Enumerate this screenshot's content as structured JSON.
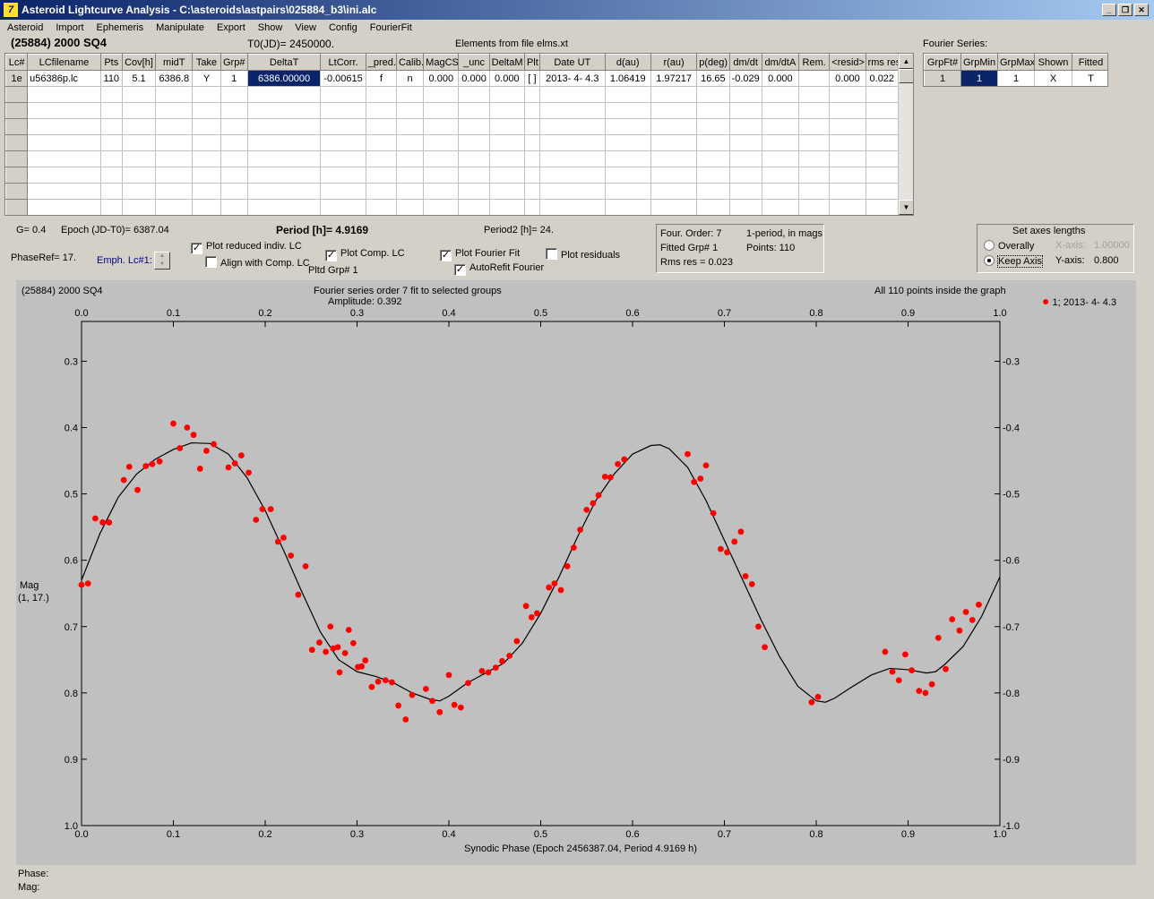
{
  "window": {
    "title": "Asteroid Lightcurve Analysis - C:\\asteroids\\astpairs\\025884_b3\\ini.alc",
    "icon": "app-icon"
  },
  "menu": [
    "Asteroid",
    "Import",
    "Ephemeris",
    "Manipulate",
    "Export",
    "Show",
    "View",
    "Config",
    "FourierFit"
  ],
  "header": {
    "asteroid": "(25884) 2000 SQ4",
    "t0": "T0(JD)= 2450000.",
    "elements": "Elements from file elms.xt",
    "fourier_series_label": "Fourier Series:"
  },
  "lc_table": {
    "columns": [
      "Lc#",
      "LCfilename",
      "Pts",
      "Cov[h]",
      "midT",
      "Take",
      "Grp#",
      "DeltaT",
      "LtCorr.",
      "_pred.",
      "Calib.",
      "MagCS",
      "_unc",
      "DeltaM",
      "Plt",
      "Date UT",
      "d(au)",
      "r(au)",
      "p(deg)",
      "dm/dt",
      "dm/dtA",
      "Rem.",
      "<resid>",
      "rms res"
    ],
    "rows": [
      [
        "1e",
        "u56386p.lc",
        "110",
        "5.1",
        "6386.8",
        "Y",
        "1",
        "6386.00000",
        "-0.00615",
        "f",
        "n",
        "0.000",
        "0.000",
        "0.000",
        "[ ]",
        "2013- 4- 4.3",
        "1.06419",
        "1.97217",
        "16.65",
        "-0.029",
        "0.000",
        "",
        "0.000",
        "0.022"
      ]
    ]
  },
  "fourier_table": {
    "columns": [
      "GrpFt#",
      "GrpMin",
      "GrpMax",
      "Shown",
      "Fitted"
    ],
    "rows": [
      [
        "1",
        "1",
        "1",
        "X",
        "T"
      ]
    ]
  },
  "controls": {
    "g": "G= 0.4",
    "epoch": "Epoch (JD-T0)= 6387.04",
    "period": "Period [h]= 4.9169",
    "period2": "Period2 [h]= 24.",
    "phase_ref": "PhaseRef= 17.",
    "emph": "Emph. Lc#1:",
    "plot_reduced": "Plot reduced indiv. LC",
    "align": "Align with Comp. LC",
    "plot_comp": "Plot Comp. LC",
    "pltd_grp": "Pltd Grp#  1",
    "plot_fourier": "Plot Fourier Fit",
    "autorefit": "AutoRefit Fourier",
    "plot_residuals": "Plot residuals"
  },
  "fit_info": {
    "order": "Four. Order:  7",
    "mode": "1-period, in mags",
    "fitted": "Fitted Grp# 1",
    "points": "Points: 110",
    "rms": "Rms res     = 0.023"
  },
  "axes_box": {
    "title": "Set axes lengths",
    "overally": "Overally",
    "keep_axis": "Keep Axis",
    "x_axis_label": "X-axis:",
    "x_axis_value": "1.00000",
    "y_axis_label": "Y-axis:",
    "y_axis_value": "0.800"
  },
  "plot": {
    "object": "(25884) 2000 SQ4",
    "title": "Fourier series order 7 fit to selected groups",
    "amplitude": "Amplitude: 0.392",
    "note": "All 110 points inside the graph",
    "legend": "1; 2013- 4- 4.3",
    "ylabel": "Mag",
    "ylabel2": "(1, 17.)",
    "xlabel": "Synodic Phase (Epoch 2456387.04, Period 4.9169 h)",
    "status_phase": "Phase:",
    "status_mag": "Mag:"
  },
  "colors": {
    "points": "#ff0000",
    "curve": "#000000",
    "plot_bg": "#c0c0c0",
    "titlebar": "#0a246a"
  },
  "chart_data": {
    "type": "scatter",
    "x_ticks": [
      "0.0",
      "0.1",
      "0.2",
      "0.3",
      "0.4",
      "0.5",
      "0.6",
      "0.7",
      "0.8",
      "0.9",
      "1.0"
    ],
    "y_ticks": [
      "0.3",
      "0.4",
      "0.5",
      "0.6",
      "0.7",
      "0.8",
      "0.9",
      "1.0"
    ],
    "xlim": [
      0,
      1
    ],
    "ylim": [
      0.24,
      1.0
    ],
    "y_inverted": true,
    "series": [
      {
        "name": "1; 2013- 4- 4.3",
        "color": "#ff0000",
        "points": [
          [
            0.0,
            0.637
          ],
          [
            0.007,
            0.635
          ],
          [
            0.015,
            0.537
          ],
          [
            0.023,
            0.543
          ],
          [
            0.03,
            0.543
          ],
          [
            0.046,
            0.479
          ],
          [
            0.052,
            0.459
          ],
          [
            0.061,
            0.494
          ],
          [
            0.07,
            0.458
          ],
          [
            0.077,
            0.455
          ],
          [
            0.085,
            0.451
          ],
          [
            0.1,
            0.394
          ],
          [
            0.107,
            0.431
          ],
          [
            0.115,
            0.4
          ],
          [
            0.122,
            0.411
          ],
          [
            0.129,
            0.462
          ],
          [
            0.136,
            0.435
          ],
          [
            0.144,
            0.425
          ],
          [
            0.16,
            0.46
          ],
          [
            0.167,
            0.454
          ],
          [
            0.174,
            0.442
          ],
          [
            0.182,
            0.468
          ],
          [
            0.19,
            0.539
          ],
          [
            0.197,
            0.523
          ],
          [
            0.206,
            0.523
          ],
          [
            0.214,
            0.572
          ],
          [
            0.22,
            0.566
          ],
          [
            0.228,
            0.593
          ],
          [
            0.236,
            0.652
          ],
          [
            0.244,
            0.609
          ],
          [
            0.251,
            0.735
          ],
          [
            0.259,
            0.724
          ],
          [
            0.266,
            0.738
          ],
          [
            0.271,
            0.7
          ],
          [
            0.274,
            0.733
          ],
          [
            0.279,
            0.731
          ],
          [
            0.281,
            0.769
          ],
          [
            0.287,
            0.74
          ],
          [
            0.291,
            0.705
          ],
          [
            0.296,
            0.725
          ],
          [
            0.301,
            0.761
          ],
          [
            0.305,
            0.76
          ],
          [
            0.309,
            0.751
          ],
          [
            0.316,
            0.791
          ],
          [
            0.323,
            0.783
          ],
          [
            0.331,
            0.781
          ],
          [
            0.338,
            0.784
          ],
          [
            0.345,
            0.819
          ],
          [
            0.353,
            0.84
          ],
          [
            0.36,
            0.803
          ],
          [
            0.375,
            0.794
          ],
          [
            0.382,
            0.812
          ],
          [
            0.39,
            0.829
          ],
          [
            0.4,
            0.773
          ],
          [
            0.406,
            0.818
          ],
          [
            0.413,
            0.822
          ],
          [
            0.421,
            0.785
          ],
          [
            0.436,
            0.767
          ],
          [
            0.443,
            0.769
          ],
          [
            0.451,
            0.762
          ],
          [
            0.458,
            0.752
          ],
          [
            0.466,
            0.744
          ],
          [
            0.474,
            0.722
          ],
          [
            0.484,
            0.669
          ],
          [
            0.49,
            0.686
          ],
          [
            0.496,
            0.68
          ],
          [
            0.509,
            0.641
          ],
          [
            0.515,
            0.635
          ],
          [
            0.522,
            0.645
          ],
          [
            0.529,
            0.609
          ],
          [
            0.536,
            0.581
          ],
          [
            0.543,
            0.554
          ],
          [
            0.55,
            0.524
          ],
          [
            0.557,
            0.514
          ],
          [
            0.563,
            0.502
          ],
          [
            0.57,
            0.474
          ],
          [
            0.576,
            0.475
          ],
          [
            0.584,
            0.455
          ],
          [
            0.591,
            0.448
          ],
          [
            0.66,
            0.44
          ],
          [
            0.667,
            0.482
          ],
          [
            0.674,
            0.477
          ],
          [
            0.68,
            0.457
          ],
          [
            0.688,
            0.529
          ],
          [
            0.696,
            0.583
          ],
          [
            0.703,
            0.588
          ],
          [
            0.711,
            0.572
          ],
          [
            0.718,
            0.557
          ],
          [
            0.723,
            0.624
          ],
          [
            0.73,
            0.636
          ],
          [
            0.737,
            0.7
          ],
          [
            0.744,
            0.731
          ],
          [
            0.795,
            0.814
          ],
          [
            0.802,
            0.806
          ],
          [
            0.875,
            0.738
          ],
          [
            0.883,
            0.768
          ],
          [
            0.89,
            0.781
          ],
          [
            0.897,
            0.742
          ],
          [
            0.904,
            0.766
          ],
          [
            0.912,
            0.797
          ],
          [
            0.919,
            0.8
          ],
          [
            0.926,
            0.787
          ],
          [
            0.933,
            0.717
          ],
          [
            0.941,
            0.764
          ],
          [
            0.948,
            0.689
          ],
          [
            0.956,
            0.706
          ],
          [
            0.963,
            0.678
          ],
          [
            0.97,
            0.69
          ],
          [
            0.977,
            0.667
          ]
        ]
      },
      {
        "name": "",
        "type": "line",
        "color": "#000000",
        "points": [
          [
            0.0,
            0.63
          ],
          [
            0.02,
            0.56
          ],
          [
            0.04,
            0.505
          ],
          [
            0.06,
            0.47
          ],
          [
            0.08,
            0.448
          ],
          [
            0.1,
            0.433
          ],
          [
            0.12,
            0.423
          ],
          [
            0.14,
            0.424
          ],
          [
            0.16,
            0.44
          ],
          [
            0.18,
            0.475
          ],
          [
            0.2,
            0.525
          ],
          [
            0.22,
            0.585
          ],
          [
            0.24,
            0.648
          ],
          [
            0.26,
            0.708
          ],
          [
            0.28,
            0.75
          ],
          [
            0.3,
            0.768
          ],
          [
            0.32,
            0.775
          ],
          [
            0.34,
            0.785
          ],
          [
            0.36,
            0.8
          ],
          [
            0.38,
            0.81
          ],
          [
            0.39,
            0.812
          ],
          [
            0.4,
            0.805
          ],
          [
            0.42,
            0.785
          ],
          [
            0.44,
            0.77
          ],
          [
            0.46,
            0.755
          ],
          [
            0.48,
            0.725
          ],
          [
            0.5,
            0.68
          ],
          [
            0.52,
            0.625
          ],
          [
            0.54,
            0.565
          ],
          [
            0.56,
            0.51
          ],
          [
            0.58,
            0.47
          ],
          [
            0.6,
            0.44
          ],
          [
            0.62,
            0.427
          ],
          [
            0.63,
            0.426
          ],
          [
            0.64,
            0.432
          ],
          [
            0.66,
            0.46
          ],
          [
            0.68,
            0.51
          ],
          [
            0.7,
            0.57
          ],
          [
            0.72,
            0.63
          ],
          [
            0.74,
            0.69
          ],
          [
            0.76,
            0.745
          ],
          [
            0.78,
            0.79
          ],
          [
            0.8,
            0.812
          ],
          [
            0.81,
            0.814
          ],
          [
            0.82,
            0.808
          ],
          [
            0.84,
            0.79
          ],
          [
            0.86,
            0.773
          ],
          [
            0.88,
            0.763
          ],
          [
            0.9,
            0.765
          ],
          [
            0.92,
            0.77
          ],
          [
            0.93,
            0.768
          ],
          [
            0.94,
            0.757
          ],
          [
            0.96,
            0.73
          ],
          [
            0.98,
            0.685
          ],
          [
            1.0,
            0.625
          ]
        ]
      }
    ]
  }
}
